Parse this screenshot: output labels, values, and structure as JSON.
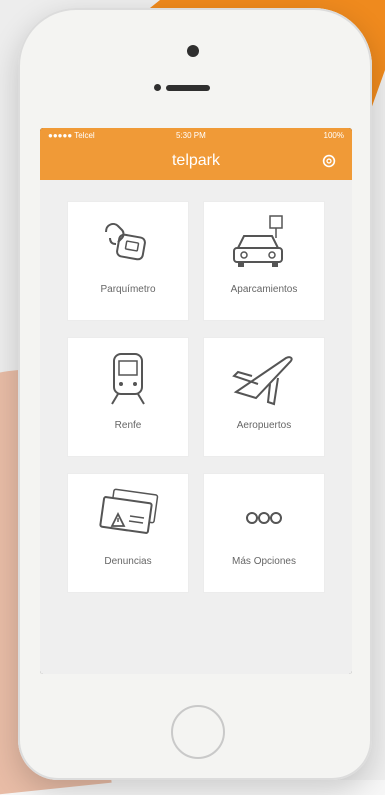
{
  "app": {
    "title": "telpark"
  },
  "status_bar": {
    "carrier": "●●●●● Telcel",
    "time": "5:30 PM",
    "battery": "100%"
  },
  "tiles": [
    {
      "label": "Parquímetro",
      "icon": "parking-meter-icon"
    },
    {
      "label": "Aparcamientos",
      "icon": "parking-lot-car-icon"
    },
    {
      "label": "Renfe",
      "icon": "train-icon"
    },
    {
      "label": "Aeropuertos",
      "icon": "airplane-icon"
    },
    {
      "label": "Denuncias",
      "icon": "fine-ticket-icon"
    },
    {
      "label": "Más Opciones",
      "icon": "more-options-icon"
    }
  ],
  "colors": {
    "accent": "#f09a37",
    "background": "#efefef",
    "tile": "#ffffff",
    "text": "#666666"
  }
}
